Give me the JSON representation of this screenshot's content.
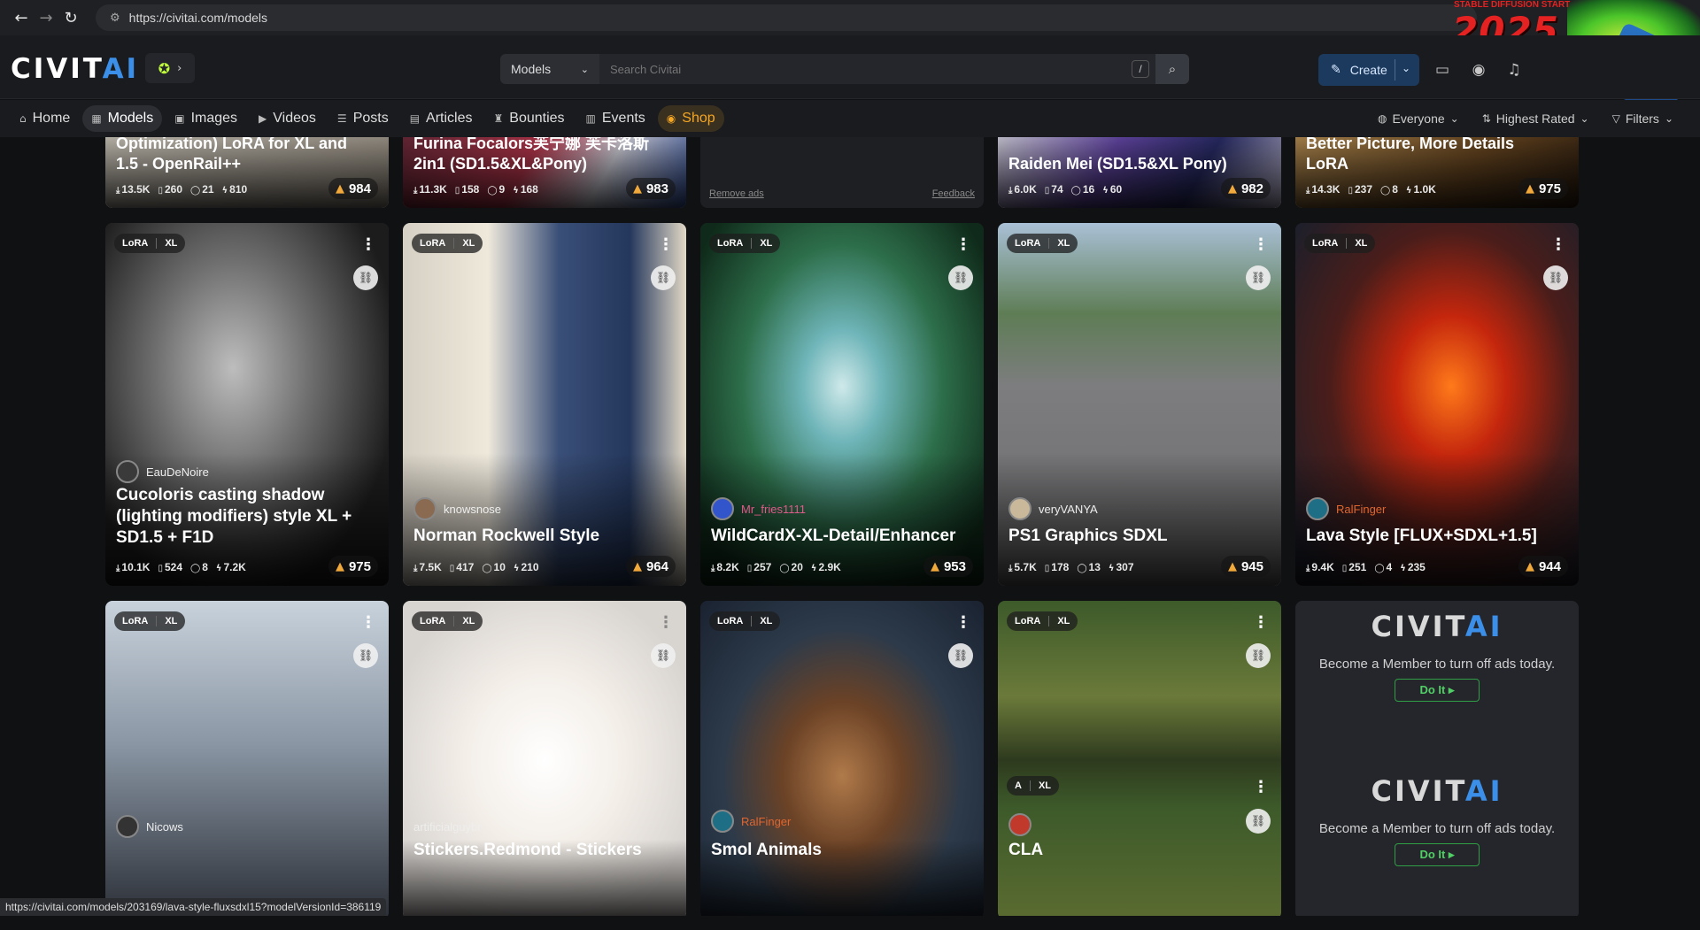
{
  "browser": {
    "url": "https://civitai.com/models",
    "back_icon": "←",
    "forward_icon": "→",
    "reload_icon": "↻"
  },
  "promo": {
    "year": "2025",
    "text": "STABLE DIFFUSION START"
  },
  "header": {
    "logo_main": "CIVIT",
    "logo_ai": "AI",
    "search_scope": "Models",
    "search_placeholder": "Search Civitai",
    "search_shortcut": "/",
    "create_label": "Create"
  },
  "tabs": [
    {
      "label": "Home",
      "icon": "⌂"
    },
    {
      "label": "Models",
      "icon": "▦"
    },
    {
      "label": "Images",
      "icon": "▣"
    },
    {
      "label": "Videos",
      "icon": "▶"
    },
    {
      "label": "Posts",
      "icon": "☰"
    },
    {
      "label": "Articles",
      "icon": "▤"
    },
    {
      "label": "Bounties",
      "icon": "♜"
    },
    {
      "label": "Events",
      "icon": "▥"
    },
    {
      "label": "Shop",
      "icon": "◉"
    }
  ],
  "filters": {
    "audience": "Everyone",
    "sort": "Highest Rated",
    "filters": "Filters"
  },
  "top_row": [
    {
      "title_line1": "Optimization) LoRA for XL and",
      "title_line2": "1.5 - OpenRail++",
      "downloads": "13.5K",
      "saves": "260",
      "comments": "21",
      "tips": "810",
      "likes": "984"
    },
    {
      "title_line1": "Furina Focalors芙宁娜 芙卡洛斯",
      "title_line2": "2in1 (SD1.5&XL&Pony)",
      "downloads": "11.3K",
      "saves": "158",
      "comments": "9",
      "tips": "168",
      "likes": "983"
    },
    {
      "remove_ads": "Remove ads",
      "feedback": "Feedback"
    },
    {
      "title_line1": "Raiden Mei (SD1.5&XL Pony)",
      "title_line2": "",
      "downloads": "6.0K",
      "saves": "74",
      "comments": "16",
      "tips": "60",
      "likes": "982"
    },
    {
      "title_line1": "Better Picture, More Details",
      "title_line2": "LoRA",
      "downloads": "14.3K",
      "saves": "237",
      "comments": "8",
      "tips": "1.0K",
      "likes": "975"
    }
  ],
  "middle_row": [
    {
      "badge1": "LoRA",
      "badge2": "XL",
      "creator": "EauDeNoire",
      "title": "Cucoloris casting shadow (lighting modifiers) style XL + SD1.5 + F1D",
      "downloads": "10.1K",
      "saves": "524",
      "comments": "8",
      "tips": "7.2K",
      "likes": "975"
    },
    {
      "badge1": "LoRA",
      "badge2": "XL",
      "creator": "knowsnose",
      "title": "Norman Rockwell Style",
      "downloads": "7.5K",
      "saves": "417",
      "comments": "10",
      "tips": "210",
      "likes": "964"
    },
    {
      "badge1": "LoRA",
      "badge2": "XL",
      "creator": "Mr_fries1111",
      "title": "WildCardX-XL-Detail/Enhancer",
      "downloads": "8.2K",
      "saves": "257",
      "comments": "20",
      "tips": "2.9K",
      "likes": "953"
    },
    {
      "badge1": "LoRA",
      "badge2": "XL",
      "creator": "veryVANYA",
      "title": "PS1 Graphics SDXL",
      "downloads": "5.7K",
      "saves": "178",
      "comments": "13",
      "tips": "307",
      "likes": "945"
    },
    {
      "badge1": "LoRA",
      "badge2": "XL",
      "creator": "RalFinger",
      "title": "Lava Style [FLUX+SDXL+1.5]",
      "downloads": "9.4K",
      "saves": "251",
      "comments": "4",
      "tips": "235",
      "likes": "944"
    }
  ],
  "bottom_row": [
    {
      "badge1": "LoRA",
      "badge2": "XL",
      "creator": "Nicows",
      "title": ""
    },
    {
      "badge1": "LoRA",
      "badge2": "XL",
      "creator": "artificialguybr",
      "title": "Stickers.Redmond - Stickers"
    },
    {
      "badge1": "LoRA",
      "badge2": "XL",
      "creator": "RalFinger",
      "title": "Smol Animals"
    },
    {
      "badge1": "LoRA",
      "badge2": "XL",
      "badge3": "A",
      "badge4": "XL",
      "creator": "",
      "title": "CLA"
    }
  ],
  "ads": [
    {
      "text": "Become a Member to turn off ads today.",
      "button": "Do It ▸"
    },
    {
      "text": "Become a Member to turn off ads today.",
      "button": "Do It ▸"
    }
  ],
  "status_url": "https://civitai.com/models/203169/lava-style-fluxsdxl15?modelVersionId=386119",
  "icons": {
    "download": "⤓",
    "save": "▯",
    "comment": "◯",
    "tip": "ϟ",
    "like": "👍︎",
    "link": "🔗︎",
    "menu": "⋮"
  }
}
